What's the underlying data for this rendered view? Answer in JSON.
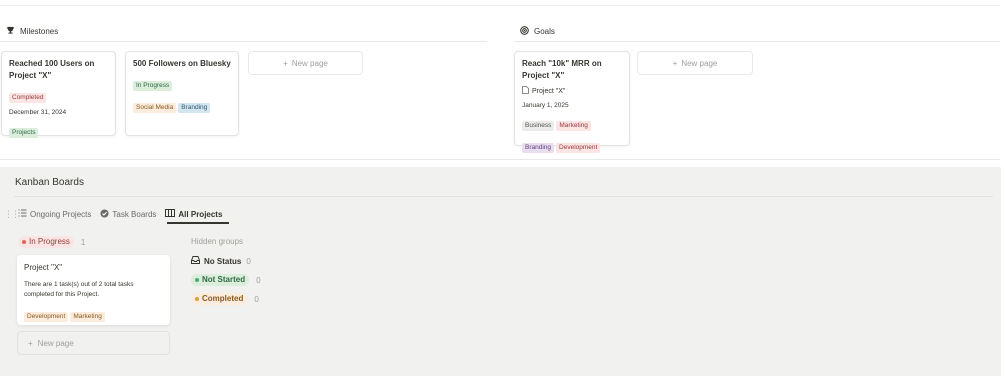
{
  "milestones": {
    "header": "Milestones",
    "icon": "trophy-icon",
    "cards": [
      {
        "title": "Reached 100 Users on Project \"X\"",
        "status": "Completed",
        "date": "December 31, 2024",
        "tags": [
          "Projects"
        ]
      },
      {
        "title": "500 Followers on Bluesky",
        "status": "In Progress",
        "tags": [
          "Social Media",
          "Branding"
        ]
      }
    ],
    "new_page_label": "New page"
  },
  "goals": {
    "header": "Goals",
    "icon": "target-icon",
    "cards": [
      {
        "title": "Reach \"10k\" MRR on Project \"X\"",
        "relation": "Project \"X\"",
        "date": "January 1, 2025",
        "tags": [
          "Business",
          "Marketing",
          "Branding",
          "Development"
        ]
      }
    ],
    "new_page_label": "New page"
  },
  "kanban": {
    "title": "Kanban Boards",
    "tabs": [
      {
        "label": "Ongoing Projects",
        "icon": "list-icon"
      },
      {
        "label": "Task Boards",
        "icon": "check-circle-icon"
      },
      {
        "label": "All Projects",
        "icon": "board-icon",
        "active": true
      }
    ],
    "column": {
      "status": "In Progress",
      "count": "1",
      "card": {
        "title": "Project \"X\"",
        "description": "There are 1 task(s) out of 2 total tasks completed for this Project.",
        "tags": [
          "Development",
          "Marketing"
        ]
      },
      "new_page_label": "New page"
    },
    "hidden_groups": {
      "label": "Hidden groups",
      "groups": [
        {
          "label": "No Status",
          "count": "0"
        },
        {
          "label": "Not Started",
          "count": "0"
        },
        {
          "label": "Completed",
          "count": "0"
        }
      ]
    }
  },
  "colors": {
    "accent_red": "#e16259",
    "accent_green": "#4dab6f",
    "accent_orange": "#d9a146",
    "panel_bg": "#f1f1ef"
  }
}
